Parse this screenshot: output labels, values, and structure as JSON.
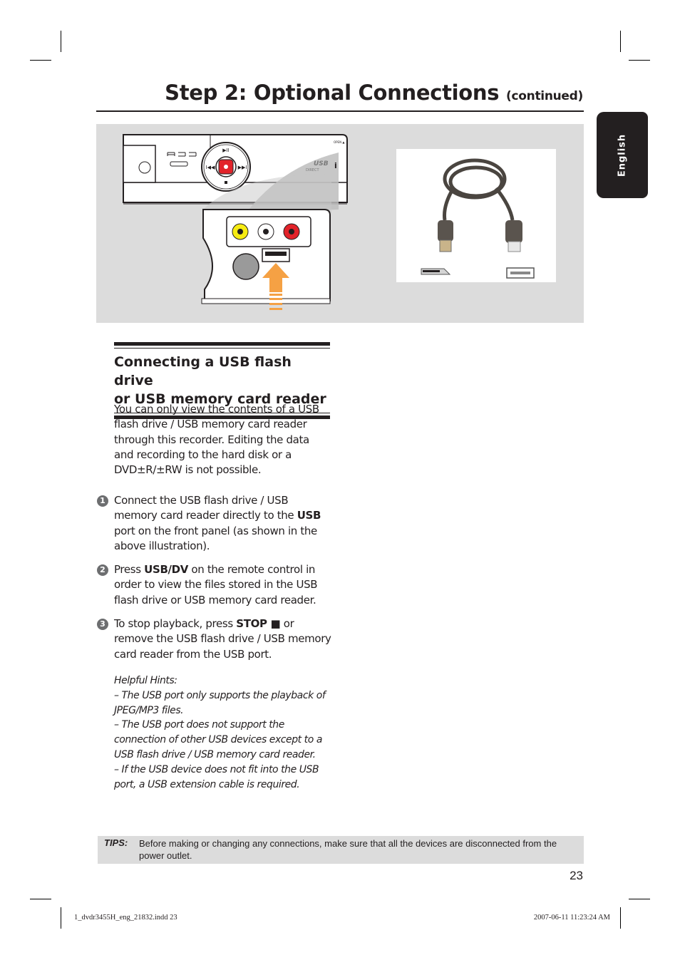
{
  "header": {
    "title": "Step 2: Optional Connections",
    "title_suffix": "(continued)"
  },
  "language_tab": "English",
  "figure": {
    "device_labels": {
      "open_label": "OPEN ▲",
      "usb_direct": "USB DIRECT",
      "hdd_label": "HDD"
    },
    "front_panel_ports": [
      "video-yellow",
      "audio-white",
      "audio-red",
      "s-video",
      "usb"
    ],
    "arrow_color": "#f5a144",
    "cable_photo_caption": "USB extension cable"
  },
  "section": {
    "heading_line1": "Connecting a USB flash drive",
    "heading_line2": "or USB memory card reader",
    "intro": "You can only view the contents of a USB flash drive / USB memory card reader through this recorder. Editing the data and recording to the hard disk or a DVD±R/±RW is not possible."
  },
  "steps": [
    {
      "number": "1",
      "pre": "Connect the USB flash drive / USB memory card reader directly to the ",
      "bold": "USB",
      "post": " port on the front panel (as shown in the above illustration)."
    },
    {
      "number": "2",
      "pre": "Press ",
      "bold": "USB/DV",
      "post": " on the remote control in order to view the files stored in the USB flash drive or USB memory card reader."
    },
    {
      "number": "3",
      "pre": "To stop playback, press ",
      "bold": "STOP ■",
      "post": " or remove the USB flash drive / USB memory card reader from the USB port."
    }
  ],
  "hints": {
    "title": "Helpful Hints:",
    "items": [
      "–  The USB port only supports the playback of JPEG/MP3 files.",
      "–  The USB port does not support the connection of other USB devices except to a USB flash drive / USB memory card reader.",
      "–  If the USB device does not fit into the USB port, a USB extension cable is required."
    ]
  },
  "tips": {
    "label": "TIPS:",
    "text": "Before making or changing any connections, make sure that all the devices are disconnected from the power outlet."
  },
  "page_number": "23",
  "slug": {
    "file": "1_dvdr3455H_eng_21832.indd   23",
    "timestamp": "2007-06-11   11:23:24 AM"
  }
}
